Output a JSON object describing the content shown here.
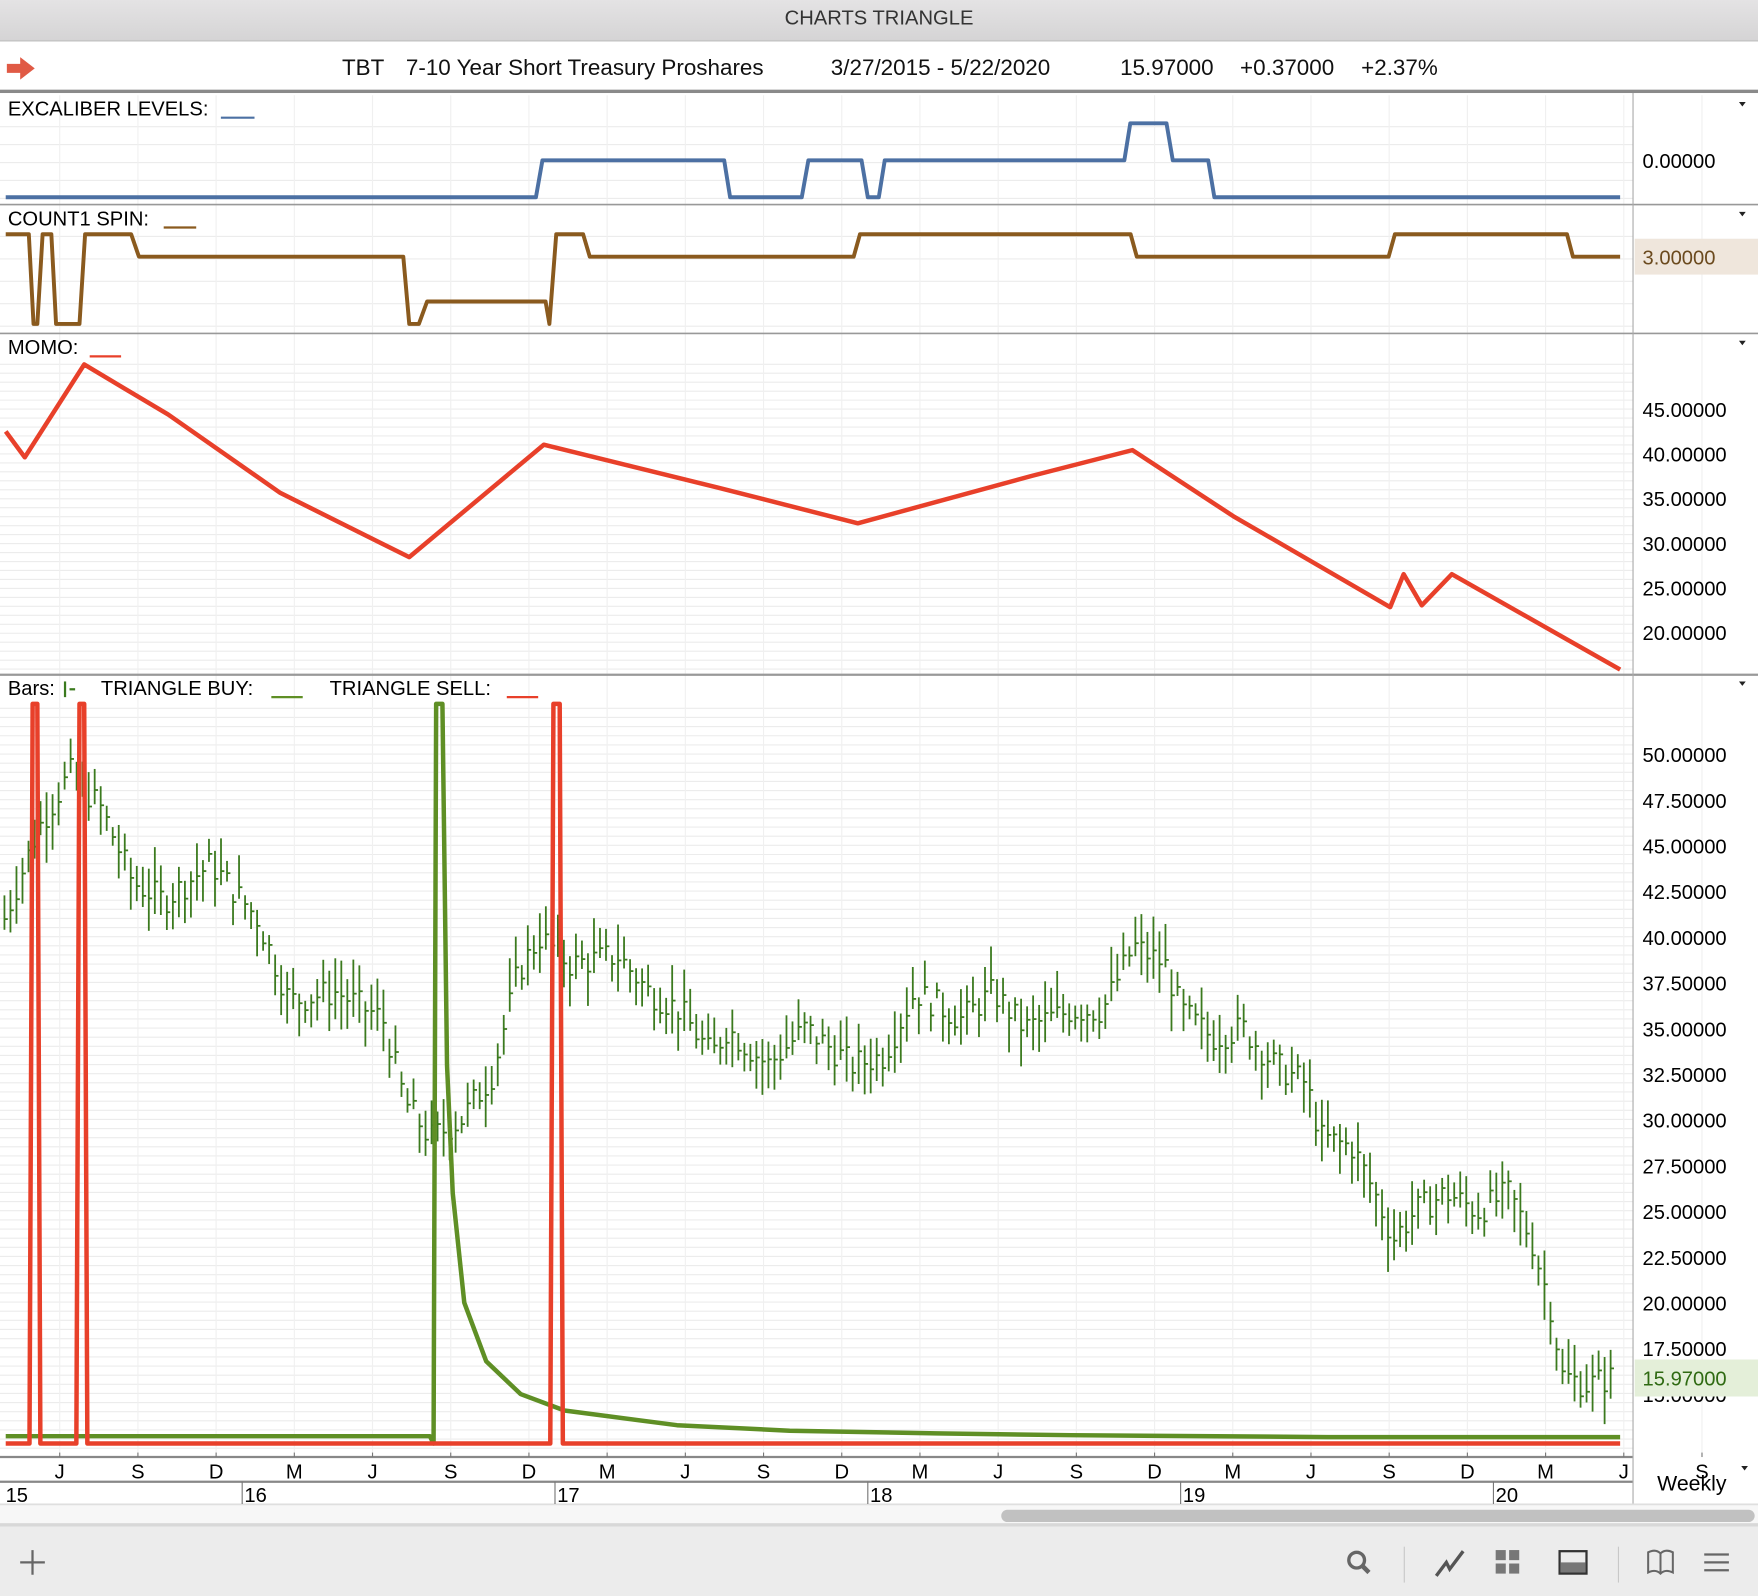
{
  "window": {
    "title": "CHARTS TRIANGLE"
  },
  "header": {
    "symbol": "TBT",
    "name": "7-10 Year Short Treasury Proshares",
    "range": "3/27/2015 - 5/22/2020",
    "last": "15.97000",
    "change": "+0.37000",
    "pct": "+2.37%"
  },
  "timeframe": "Weekly",
  "colors": {
    "excaliber": "#4c70a3",
    "count1": "#8a5a1e",
    "momo": "#e8402a",
    "bars": "#3b7a1e",
    "buy": "#5f8f25",
    "sell": "#e8402a"
  },
  "chart_data": [
    {
      "type": "line",
      "title": "EXCALIBER LEVELS:",
      "axis_label": "0.00000",
      "step": true,
      "points": [
        [
          2015.244,
          -1
        ],
        [
          2016.939,
          -1
        ],
        [
          2016.96,
          0
        ],
        [
          2017.541,
          0
        ],
        [
          2017.56,
          -1
        ],
        [
          2017.789,
          -1
        ],
        [
          2017.81,
          0
        ],
        [
          2017.98,
          0
        ],
        [
          2018.0,
          -1
        ],
        [
          2018.035,
          -1
        ],
        [
          2018.054,
          0
        ],
        [
          2018.82,
          0
        ],
        [
          2018.839,
          1
        ],
        [
          2018.955,
          1
        ],
        [
          2018.975,
          0
        ],
        [
          2019.088,
          0
        ],
        [
          2019.108,
          -1
        ],
        [
          2020.405,
          -1
        ]
      ]
    },
    {
      "type": "line",
      "title": "COUNT1 SPIN:",
      "axis_label": "3.00000",
      "last_value": 3,
      "points": [
        [
          2015.244,
          4
        ],
        [
          2015.318,
          4
        ],
        [
          2015.333,
          0
        ],
        [
          2015.345,
          0
        ],
        [
          2015.362,
          4
        ],
        [
          2015.39,
          4
        ],
        [
          2015.405,
          0
        ],
        [
          2015.48,
          0
        ],
        [
          2015.498,
          4
        ],
        [
          2015.645,
          4
        ],
        [
          2015.67,
          3
        ],
        [
          2016.515,
          3
        ],
        [
          2016.534,
          0
        ],
        [
          2016.565,
          0
        ],
        [
          2016.591,
          1
        ],
        [
          2016.97,
          1
        ],
        [
          2016.982,
          0
        ],
        [
          2017.004,
          4
        ],
        [
          2017.09,
          4
        ],
        [
          2017.111,
          3
        ],
        [
          2017.955,
          3
        ],
        [
          2017.975,
          4
        ],
        [
          2018.84,
          4
        ],
        [
          2018.86,
          3
        ],
        [
          2019.665,
          3
        ],
        [
          2019.685,
          4
        ],
        [
          2020.235,
          4
        ],
        [
          2020.254,
          3
        ],
        [
          2020.405,
          3
        ]
      ]
    },
    {
      "type": "line",
      "title": "MOMO:",
      "yticks": [
        "45.00000",
        "40.00000",
        "35.00000",
        "30.00000",
        "25.00000",
        "20.00000"
      ],
      "ytick_values": [
        45,
        40,
        35,
        30,
        25,
        20
      ],
      "points": [
        [
          2015.244,
          42.5
        ],
        [
          2015.305,
          39.6
        ],
        [
          2015.495,
          50
        ],
        [
          2015.763,
          44.4
        ],
        [
          2016.122,
          35.6
        ],
        [
          2016.534,
          28.4
        ],
        [
          2016.964,
          41
        ],
        [
          2017.52,
          36.2
        ],
        [
          2017.968,
          32.2
        ],
        [
          2018.523,
          37.5
        ],
        [
          2018.846,
          40.4
        ],
        [
          2019.168,
          33
        ],
        [
          2019.67,
          22.8
        ],
        [
          2019.713,
          26.5
        ],
        [
          2019.771,
          23
        ],
        [
          2019.867,
          26.5
        ],
        [
          2020.405,
          15.8
        ]
      ]
    },
    {
      "type": "bar",
      "title": "Bars:",
      "legend": [
        {
          "label": "TRIANGLE BUY:"
        },
        {
          "label": "TRIANGLE SELL:"
        }
      ],
      "yticks": [
        "50.00000",
        "47.50000",
        "45.00000",
        "42.50000",
        "40.00000",
        "37.50000",
        "35.00000",
        "32.50000",
        "30.00000",
        "27.50000",
        "25.00000",
        "22.50000",
        "20.00000",
        "17.50000",
        "15.00000"
      ],
      "ytick_values": [
        50,
        47.5,
        45,
        42.5,
        40,
        37.5,
        35,
        32.5,
        30,
        27.5,
        25,
        22.5,
        20,
        17.5,
        15
      ],
      "last_price": "15.97000",
      "price_path": [
        [
          2015.24,
          41
        ],
        [
          2015.35,
          46
        ],
        [
          2015.45,
          49
        ],
        [
          2015.55,
          47
        ],
        [
          2015.65,
          43
        ],
        [
          2015.75,
          42
        ],
        [
          2015.9,
          44
        ],
        [
          2016.05,
          41
        ],
        [
          2016.15,
          36.5
        ],
        [
          2016.3,
          37
        ],
        [
          2016.45,
          35.5
        ],
        [
          2016.52,
          31
        ],
        [
          2016.6,
          29
        ],
        [
          2016.7,
          30
        ],
        [
          2016.8,
          32.5
        ],
        [
          2016.88,
          38
        ],
        [
          2016.95,
          40
        ],
        [
          2017.05,
          38.5
        ],
        [
          2017.2,
          39
        ],
        [
          2017.3,
          37
        ],
        [
          2017.4,
          36
        ],
        [
          2017.5,
          33.5
        ],
        [
          2017.55,
          35
        ],
        [
          2017.68,
          33
        ],
        [
          2017.8,
          35
        ],
        [
          2017.95,
          33
        ],
        [
          2018.05,
          33.5
        ],
        [
          2018.15,
          37
        ],
        [
          2018.3,
          35.5
        ],
        [
          2018.4,
          37
        ],
        [
          2018.5,
          35
        ],
        [
          2018.65,
          36
        ],
        [
          2018.75,
          36
        ],
        [
          2018.85,
          39.5
        ],
        [
          2018.95,
          38.5
        ],
        [
          2019.0,
          36
        ],
        [
          2019.1,
          34.5
        ],
        [
          2019.2,
          35
        ],
        [
          2019.3,
          33
        ],
        [
          2019.4,
          32
        ],
        [
          2019.45,
          29
        ],
        [
          2019.55,
          28.5
        ],
        [
          2019.62,
          26
        ],
        [
          2019.68,
          23.5
        ],
        [
          2019.75,
          25
        ],
        [
          2019.85,
          26
        ],
        [
          2019.95,
          25
        ],
        [
          2020.05,
          26
        ],
        [
          2020.12,
          23.5
        ],
        [
          2020.18,
          20
        ],
        [
          2020.22,
          16
        ],
        [
          2020.3,
          15.5
        ],
        [
          2020.39,
          15.97
        ]
      ],
      "triangle_buy": [
        [
          2015.244,
          12.7
        ],
        [
          2016.6,
          12.7
        ],
        [
          2016.612,
          12.3
        ],
        [
          2016.62,
          55
        ],
        [
          2016.64,
          55
        ],
        [
          2016.655,
          33
        ],
        [
          2016.673,
          26
        ],
        [
          2016.71,
          20
        ],
        [
          2016.78,
          16.8
        ],
        [
          2016.89,
          15
        ],
        [
          2017.03,
          14.1
        ],
        [
          2017.39,
          13.3
        ],
        [
          2017.75,
          13.0
        ],
        [
          2018.22,
          12.85
        ],
        [
          2018.65,
          12.75
        ],
        [
          2019.47,
          12.65
        ],
        [
          2020.405,
          12.65
        ]
      ],
      "triangle_sell": [
        [
          2015.244,
          12.3
        ],
        [
          2015.32,
          12.3
        ],
        [
          2015.33,
          55
        ],
        [
          2015.345,
          55
        ],
        [
          2015.355,
          12.3
        ],
        [
          2015.47,
          12.3
        ],
        [
          2015.48,
          55
        ],
        [
          2015.495,
          55
        ],
        [
          2015.505,
          12.3
        ],
        [
          2016.985,
          12.3
        ],
        [
          2016.995,
          55
        ],
        [
          2017.015,
          55
        ],
        [
          2017.025,
          12.3
        ],
        [
          2020.405,
          12.3
        ]
      ]
    }
  ],
  "x_axis": {
    "months": [
      "J",
      "S",
      "D",
      "M",
      "J",
      "S",
      "D",
      "M",
      "J",
      "S",
      "D",
      "M",
      "J",
      "S",
      "D",
      "M",
      "J",
      "S",
      "D",
      "M",
      "J",
      "S",
      "D",
      "M"
    ],
    "years": [
      "15",
      "16",
      "17",
      "18",
      "19",
      "20"
    ]
  }
}
